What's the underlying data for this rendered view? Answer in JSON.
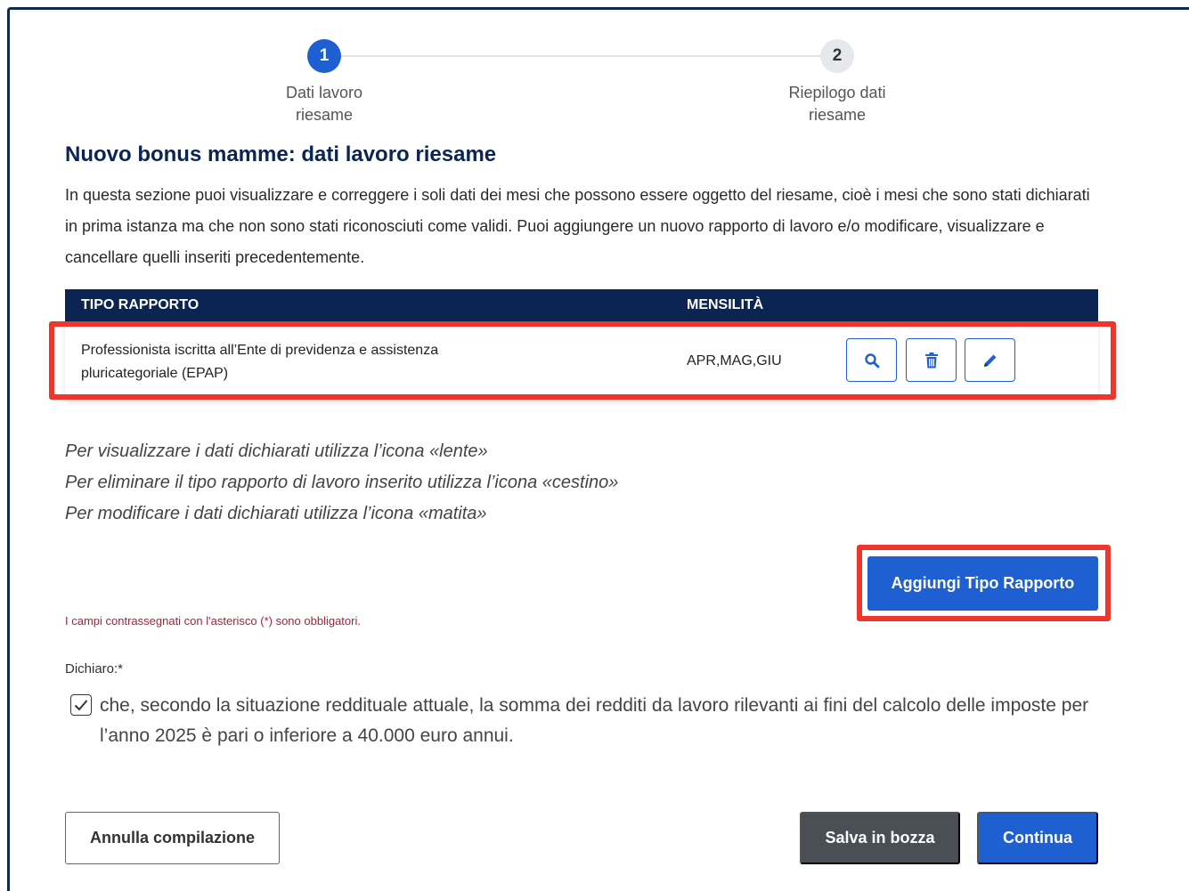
{
  "stepper": {
    "steps": [
      {
        "number": "1",
        "label": "Dati lavoro\nriesame",
        "state": "active"
      },
      {
        "number": "2",
        "label": "Riepilogo dati\nriesame",
        "state": "inactive"
      }
    ]
  },
  "page": {
    "title": "Nuovo bonus mamme: dati lavoro riesame",
    "intro": "In questa sezione puoi visualizzare e correggere i soli dati dei mesi che possono essere oggetto del riesame, cioè i mesi che sono stati dichiarati in prima istanza ma che non sono stati riconosciuti come validi. Puoi aggiungere un nuovo rapporto di lavoro e/o modificare, visualizzare e cancellare quelli inseriti precedentemente."
  },
  "table": {
    "headers": [
      "TIPO RAPPORTO",
      "MENSILITÀ"
    ],
    "rows": [
      {
        "tipo": "Professionista iscritta all’Ente di previdenza e assistenza pluricategoriale (EPAP)",
        "mensilita": "APR,MAG,GIU",
        "actions": [
          "search-icon",
          "trash-icon",
          "pencil-icon"
        ]
      }
    ]
  },
  "hints": [
    "Per visualizzare i dati dichiarati utilizza l’icona «lente»",
    "Per eliminare il tipo rapporto di lavoro inserito utilizza l’icona «cestino»",
    "Per modificare i dati dichiarati utilizza l’icona «matita»"
  ],
  "add_button_label": "Aggiungi Tipo Rapporto",
  "mandatory_note": "I campi contrassegnati con l'asterisco (*) sono obbligatori.",
  "declaration": {
    "label": "Dichiaro:*",
    "checked": true,
    "text": "che, secondo la situazione reddituale attuale, la somma dei redditi da lavoro rilevanti ai fini del calcolo delle imposte per l’anno 2025 è pari o inferiore a 40.000 euro annui."
  },
  "footer": {
    "cancel_label": "Annulla compilazione",
    "draft_label": "Salva in bozza",
    "continue_label": "Continua"
  },
  "colors": {
    "primary": "#1e5fd1",
    "navy": "#0b2452",
    "highlight": "#f0352c",
    "mandatory": "#a0253b"
  }
}
